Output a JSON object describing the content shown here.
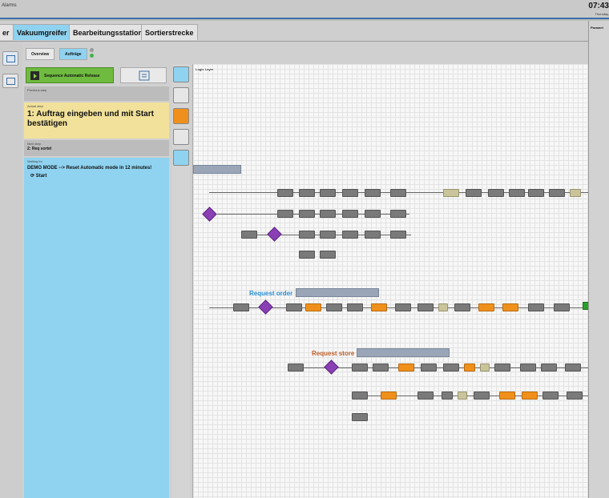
{
  "topbar": {
    "alarms_label": "Alarms",
    "time": "07:43",
    "date": "Thursday, "
  },
  "tabs": [
    {
      "label": "er",
      "active": false
    },
    {
      "label": "Vakuumgreifer",
      "active": true
    },
    {
      "label": "Bearbeitungsstation",
      "active": false
    },
    {
      "label": "Sortierstrecke",
      "active": false
    }
  ],
  "params": {
    "label": "Paramet"
  },
  "subtabs": {
    "overview": "Overview",
    "orders": "Aufträge"
  },
  "status_colors": {
    "led_top": "#9a9a9a",
    "led_bottom": "#3fb44a",
    "accent_blue": "#8fd3f0",
    "accent_green": "#6fbb3f",
    "actual_yellow": "#f1e19a"
  },
  "sequence": {
    "release_label": "Sequence Automatic Release",
    "previous_label": "Previous step",
    "actual_label": "Actual step",
    "actual_text": "1: Auftrag eingeben und mit Start bestätigen",
    "next_label": "Next step",
    "next_text": "2: Req sortel",
    "waiting_label": "Waiting for",
    "waiting_text": "DEMO MODE --> Reset Automatic mode in 12 minutes!",
    "start_text": "Start"
  },
  "canvas": {
    "title": "Logic Layer",
    "request_order": "Request order",
    "request_store": "Request store"
  }
}
